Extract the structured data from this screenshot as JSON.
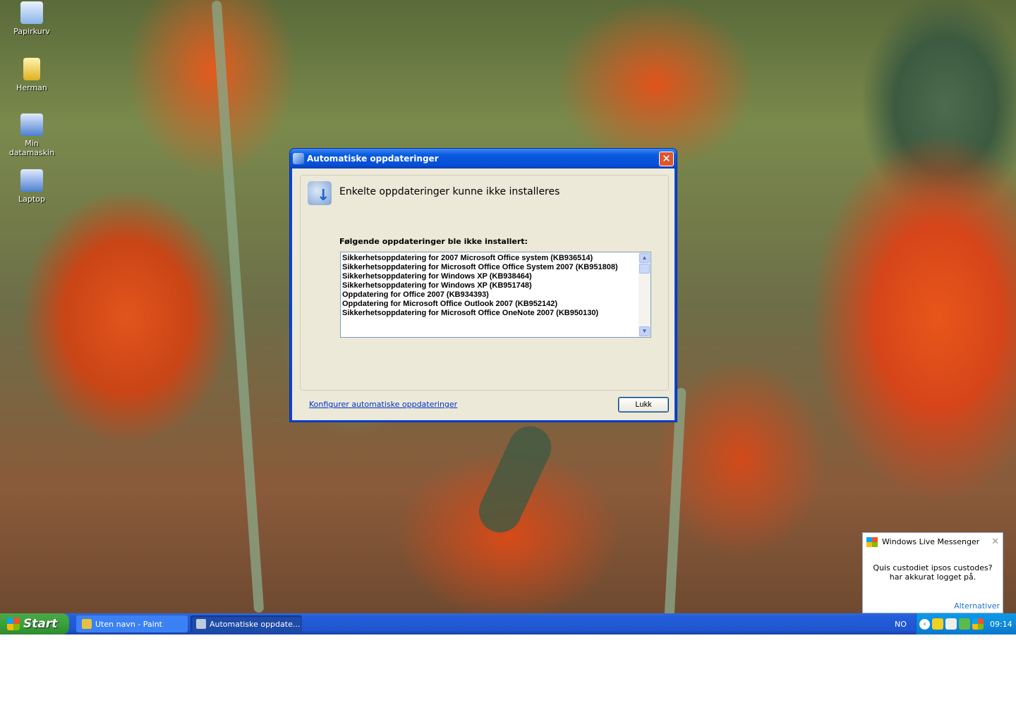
{
  "desktop": {
    "icons": [
      {
        "label": "Papirkurv"
      },
      {
        "label": "Herman"
      },
      {
        "label": "Min datamaskin"
      },
      {
        "label": "Laptop"
      }
    ]
  },
  "dialog": {
    "title": "Automatiske oppdateringer",
    "close": "✕",
    "heading": "Enkelte oppdateringer kunne ikke installeres",
    "sublabel": "Følgende oppdateringer ble ikke installert:",
    "updates": [
      "Sikkerhetsoppdatering for 2007 Microsoft Office system (KB936514)",
      "Sikkerhetsoppdatering for Microsoft Office Office System 2007 (KB951808)",
      "Sikkerhetsoppdatering for Windows XP (KB938464)",
      "Sikkerhetsoppdatering for Windows XP (KB951748)",
      "Oppdatering for Office 2007 (KB934393)",
      "Oppdatering for Microsoft Office Outlook 2007 (KB952142)",
      "Sikkerhetsoppdatering for Microsoft Office OneNote 2007 (KB950130)"
    ],
    "link": "Konfigurer automatiske oppdateringer",
    "button": "Lukk"
  },
  "toast": {
    "title": "Windows Live Messenger",
    "line1": "Quis custodiet ipsos custodes?",
    "line2": "har akkurat logget på.",
    "options": "Alternativer",
    "close": "✕"
  },
  "taskbar": {
    "start": "Start",
    "tasks": [
      {
        "label": "Uten navn - Paint"
      },
      {
        "label": "Automatiske oppdate..."
      }
    ],
    "language": "NO",
    "clock": "09:14"
  }
}
